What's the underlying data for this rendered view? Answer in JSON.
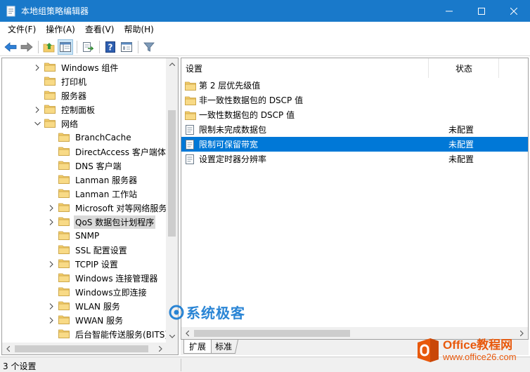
{
  "window": {
    "title": "本地组策略编辑器",
    "accent": "#1979ca"
  },
  "menu": [
    "文件(F)",
    "操作(A)",
    "查看(V)",
    "帮助(H)"
  ],
  "toolbar": {
    "buttons": [
      "back-icon",
      "forward-icon",
      "up-folder-icon",
      "show-tree-icon",
      "export-list-icon",
      "help-icon",
      "properties-icon",
      "filter-icon"
    ]
  },
  "tree": {
    "items": [
      {
        "label": "Windows 组件",
        "expander": "right",
        "indent": 0
      },
      {
        "label": "打印机",
        "expander": "none",
        "indent": 0
      },
      {
        "label": "服务器",
        "expander": "none",
        "indent": 0
      },
      {
        "label": "控制面板",
        "expander": "right",
        "indent": 0
      },
      {
        "label": "网络",
        "expander": "down",
        "indent": 0
      },
      {
        "label": "BranchCache",
        "expander": "none",
        "indent": 1
      },
      {
        "label": "DirectAccess 客户端体验",
        "expander": "none",
        "indent": 1
      },
      {
        "label": "DNS 客户端",
        "expander": "none",
        "indent": 1
      },
      {
        "label": "Lanman 服务器",
        "expander": "none",
        "indent": 1
      },
      {
        "label": "Lanman 工作站",
        "expander": "none",
        "indent": 1
      },
      {
        "label": "Microsoft 对等网络服务",
        "expander": "right",
        "indent": 1
      },
      {
        "label": "QoS 数据包计划程序",
        "expander": "right",
        "indent": 1,
        "selected": true
      },
      {
        "label": "SNMP",
        "expander": "none",
        "indent": 1
      },
      {
        "label": "SSL 配置设置",
        "expander": "none",
        "indent": 1
      },
      {
        "label": "TCPIP 设置",
        "expander": "right",
        "indent": 1
      },
      {
        "label": "Windows 连接管理器",
        "expander": "none",
        "indent": 1
      },
      {
        "label": "Windows立即连接",
        "expander": "none",
        "indent": 1
      },
      {
        "label": "WLAN 服务",
        "expander": "right",
        "indent": 1
      },
      {
        "label": "WWAN 服务",
        "expander": "right",
        "indent": 1
      },
      {
        "label": "后台智能传送服务(BITS)",
        "expander": "none",
        "indent": 1
      }
    ]
  },
  "list": {
    "columns": [
      "设置",
      "状态"
    ],
    "rows": [
      {
        "name": "第 2 层优先级值",
        "state": "",
        "type": "folder"
      },
      {
        "name": "非一致性数据包的 DSCP 值",
        "state": "",
        "type": "folder"
      },
      {
        "name": "一致性数据包的 DSCP 值",
        "state": "",
        "type": "folder"
      },
      {
        "name": "限制未完成数据包",
        "state": "未配置",
        "type": "setting"
      },
      {
        "name": "限制可保留带宽",
        "state": "未配置",
        "type": "setting",
        "selected": true
      },
      {
        "name": "设置定时器分辨率",
        "state": "未配置",
        "type": "setting"
      }
    ]
  },
  "tabs": [
    "扩展",
    "标准"
  ],
  "status": {
    "text": "3 个设置"
  },
  "watermarks": {
    "center": "系统极客",
    "brand": "Office教程网",
    "url": "www.office26.com"
  },
  "colors": {
    "selection": "#0078d7",
    "tree_selection": "#d9d9d9",
    "folder": "#f3cd6a",
    "watermark_blue": "#1f7fd3",
    "watermark_orange": "#e8590c"
  }
}
